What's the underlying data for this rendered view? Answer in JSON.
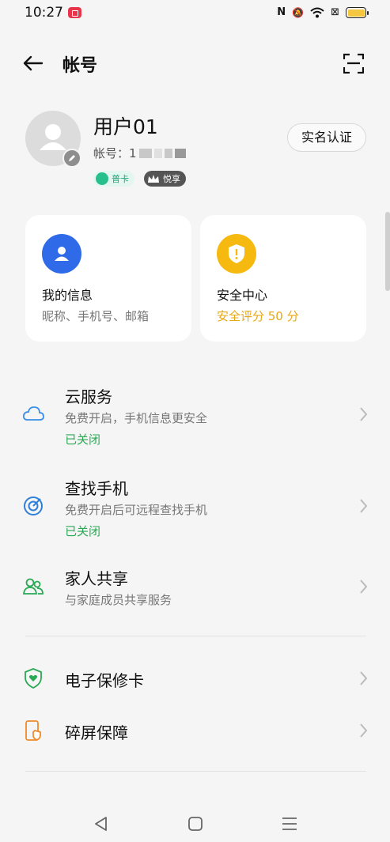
{
  "status": {
    "time": "10:27",
    "nfc": "N",
    "mute": "🔕",
    "wifi": "WiFi",
    "sim": "⊠"
  },
  "header": {
    "title": "帐号"
  },
  "profile": {
    "name": "用户01",
    "account_prefix": "帐号：1",
    "badge_card": "普卡",
    "badge_vip": "悦享",
    "verify_label": "实名认证"
  },
  "tiles": [
    {
      "title": "我的信息",
      "subtitle": "昵称、手机号、邮箱",
      "icon": "person-icon",
      "color": "#2f6ae8"
    },
    {
      "title": "安全中心",
      "subtitle": "安全评分 50 分",
      "icon": "shield-warning-icon",
      "color": "#f5b90f"
    }
  ],
  "list": [
    {
      "title": "云服务",
      "subtitle": "免费开启，手机信息更安全",
      "status": "已关闭",
      "icon": "cloud-icon"
    },
    {
      "title": "查找手机",
      "subtitle": "免费开启后可远程查找手机",
      "status": "已关闭",
      "icon": "target-icon"
    },
    {
      "title": "家人共享",
      "subtitle": "与家庭成员共享服务",
      "icon": "family-icon"
    },
    {
      "title": "电子保修卡",
      "icon": "shield-heart-icon"
    },
    {
      "title": "碎屏保障",
      "icon": "phone-protect-icon"
    }
  ],
  "colors": {
    "accent_green": "#2aa955",
    "warn": "#e8a715",
    "primary": "#2f6ae8"
  }
}
